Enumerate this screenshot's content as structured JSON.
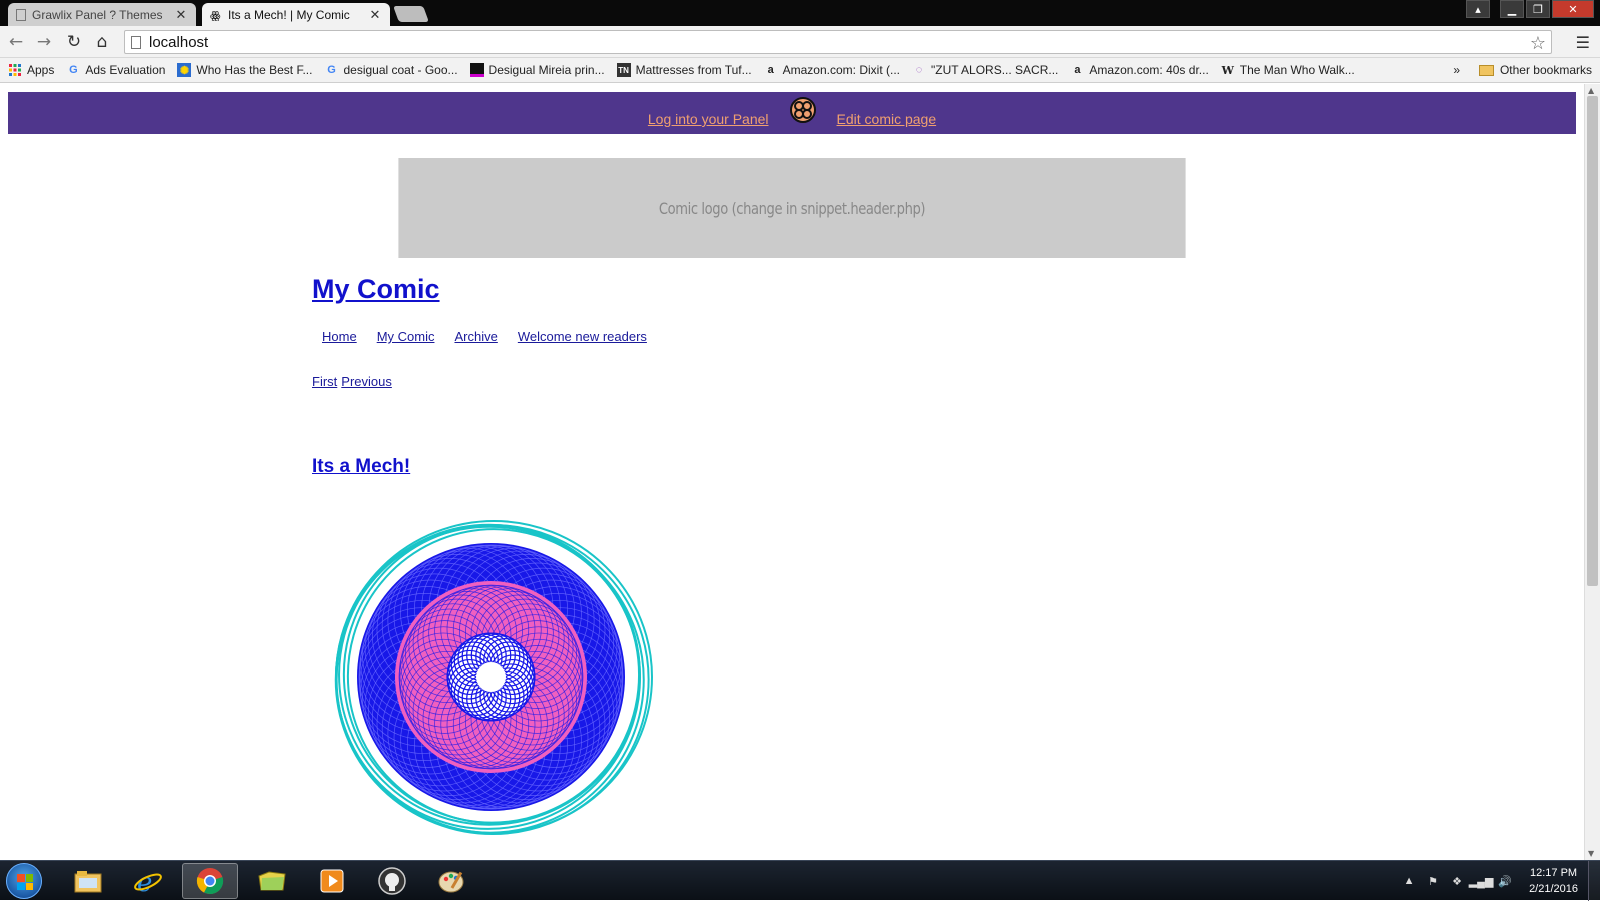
{
  "browser": {
    "tabs": [
      {
        "title": "Grawlix Panel ? Themes",
        "active": false
      },
      {
        "title": "Its a Mech! | My Comic",
        "active": true
      }
    ],
    "address": "localhost",
    "bookmarks": [
      {
        "label": "Apps",
        "icon": "apps-grid-icon"
      },
      {
        "label": "Ads Evaluation",
        "icon": "google-icon"
      },
      {
        "label": "Who Has the Best F...",
        "icon": "site-icon"
      },
      {
        "label": "desigual coat - Goo...",
        "icon": "google-icon"
      },
      {
        "label": "Desigual Mireia prin...",
        "icon": "site-icon"
      },
      {
        "label": "Mattresses from Tuf...",
        "icon": "tn-icon"
      },
      {
        "label": "Amazon.com: Dixit (...",
        "icon": "amazon-icon"
      },
      {
        "label": "\"ZUT ALORS... SACR...",
        "icon": "chat-icon"
      },
      {
        "label": "Amazon.com: 40s dr...",
        "icon": "amazon-icon"
      },
      {
        "label": "The Man Who Walk...",
        "icon": "wikipedia-icon"
      }
    ],
    "bookmarks_more": "»",
    "other_bookmarks": "Other bookmarks"
  },
  "adminbar": {
    "login_link": "Log into your Panel",
    "edit_link": "Edit comic page",
    "bg_color": "#4f368c",
    "link_color": "#f0a070"
  },
  "header": {
    "logo_placeholder": "Comic logo (change in snippet.header.php)",
    "site_title": "My Comic"
  },
  "nav": {
    "items": [
      "Home",
      "My Comic",
      "Archive",
      "Welcome new readers"
    ]
  },
  "pager": {
    "first": "First",
    "previous": "Previous"
  },
  "comic": {
    "title": "Its a Mech!",
    "ring_colors": [
      "#19c4c8",
      "#1818e8",
      "#f060c0"
    ]
  },
  "taskbar": {
    "apps": [
      "file-explorer-icon",
      "internet-explorer-icon",
      "chrome-icon",
      "folder-icon",
      "media-player-icon",
      "github-icon",
      "paint-icon"
    ],
    "time": "12:17 PM",
    "date": "2/21/2016"
  }
}
